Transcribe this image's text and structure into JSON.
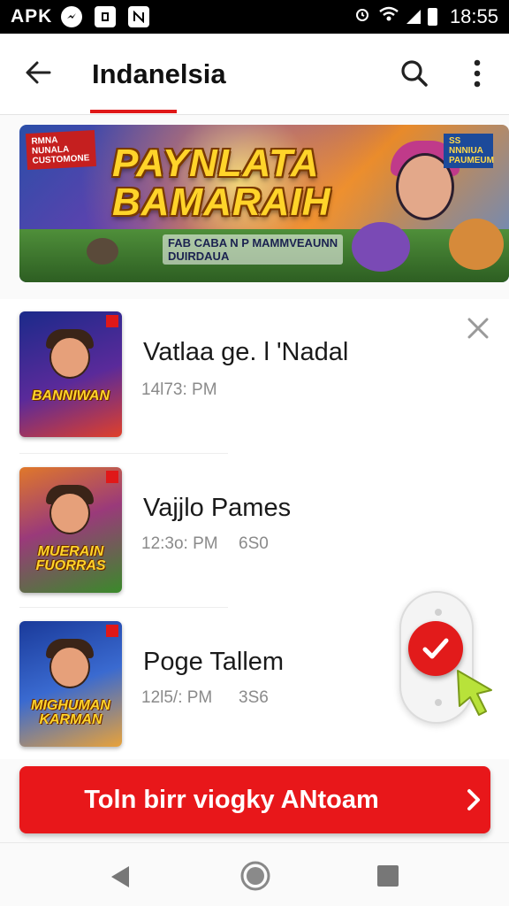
{
  "status_bar": {
    "carrier": "APK",
    "time": "18:55",
    "icons": [
      "messenger-icon",
      "app-icon",
      "notification-icon",
      "alarm-icon",
      "wifi-icon",
      "signal-icon",
      "battery-icon"
    ]
  },
  "app_bar": {
    "title": "Indanelsia",
    "back_icon": "arrow-left-icon",
    "search_icon": "search-icon",
    "more_icon": "more-vertical-icon"
  },
  "banner": {
    "tag_left": "RMNA NUNALA CUSTOMONE",
    "tag_right": "SS NNNIUA PAUMEUM",
    "title_line1": "PAYNLATA",
    "title_line2": "BAMARAIH",
    "subtitle_line1": "FAB CABA N P MAMMVEAUNN",
    "subtitle_line2": "DUIRDAUA"
  },
  "list": {
    "dismiss_icon": "close-icon",
    "items": [
      {
        "title": "Vatlaa ge. l 'Nadal",
        "time": "14l73: PM",
        "size": "",
        "thumb_logo": "BANNIWAN",
        "thumb_colors": [
          "#1b2a8a",
          "#e0402a"
        ]
      },
      {
        "title": "Vajjlo Pames",
        "time": "12:3o: PM",
        "size": "6S0",
        "thumb_logo": "MUERAIN FUORRAS",
        "thumb_colors": [
          "#e0782a",
          "#3a8a2a"
        ]
      },
      {
        "title": "Poge Tallem",
        "time": "12l5/: PM",
        "size": "3S6",
        "thumb_logo": "MIGHUMAN KARMAN",
        "thumb_colors": [
          "#1a3a9a",
          "#e8a23a"
        ]
      }
    ]
  },
  "floating_toggle": {
    "check_icon": "check-icon",
    "cursor_icon": "pointer-cursor-icon"
  },
  "cta": {
    "label": "Toln birr viogky ANtoam",
    "chevron_icon": "chevron-right-icon"
  },
  "nav_bar": {
    "back_icon": "nav-back-icon",
    "home_icon": "nav-home-icon",
    "recents_icon": "nav-recents-icon"
  },
  "colors": {
    "accent": "#e8171a",
    "underline": "#e01818",
    "text_primary": "#1a1a1a",
    "text_secondary": "#8a8a8a"
  }
}
